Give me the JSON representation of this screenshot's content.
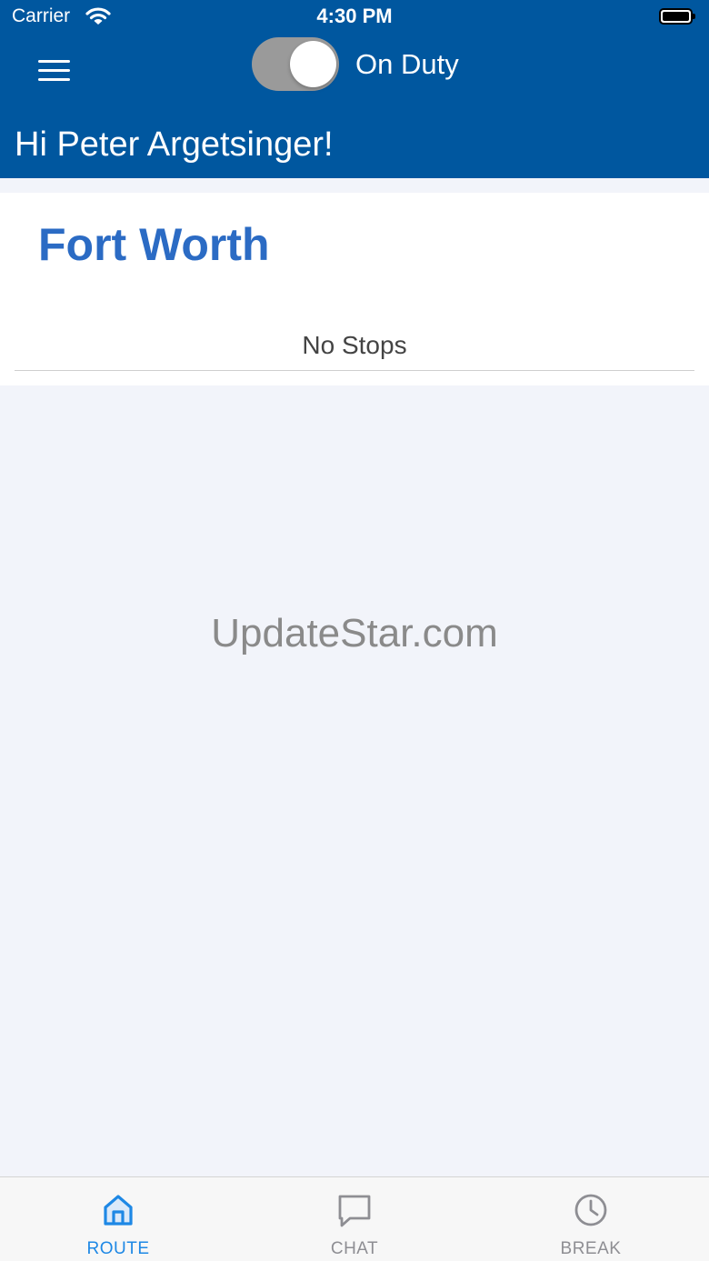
{
  "status_bar": {
    "carrier": "Carrier",
    "time": "4:30 PM"
  },
  "header": {
    "duty_toggle": {
      "label": "On Duty",
      "state": "on"
    },
    "greeting": "Hi Peter Argetsinger!"
  },
  "route_card": {
    "city": "Fort Worth",
    "empty_message": "No Stops"
  },
  "watermark": "UpdateStar.com",
  "tabs": [
    {
      "label": "ROUTE",
      "icon": "home-icon",
      "active": true
    },
    {
      "label": "CHAT",
      "icon": "chat-bubble-icon",
      "active": false
    },
    {
      "label": "BREAK",
      "icon": "clock-icon",
      "active": false
    }
  ],
  "colors": {
    "header_bg": "#00579f",
    "city_text": "#2b6bc4",
    "tab_active": "#1e88e5",
    "tab_inactive": "#8e8e93",
    "page_bg": "#f2f4fa"
  }
}
